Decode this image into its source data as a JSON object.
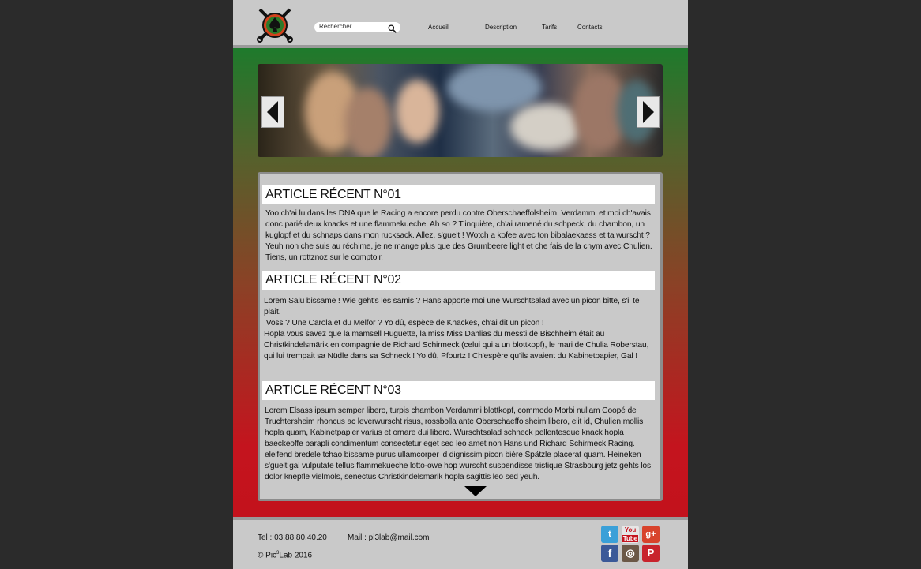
{
  "header": {
    "search_placeholder": "Rechercher...",
    "nav": [
      "Accueil",
      "Description",
      "Tarifs",
      "Contacts"
    ]
  },
  "articles": [
    {
      "title": "ARTICLE RÉCENT N°01",
      "text": "Yoo ch'ai lu dans les DNA que le Racing a encore perdu contre Oberschaeffolsheim. Verdammi et moi ch'avais donc parié deux knacks et une flammekueche. Ah so ? T'inquiète, ch'ai ramené du schpeck, du chambon, un kuglopf et du schnaps dans mon rucksack. Allez, s'guelt ! Wotch a kofee avec ton bibalaekaess et ta wurscht ? Yeuh non che suis au réchime, je ne mange plus que des Grumbeere light et che fais de la chym avec Chulien. Tiens, un rottznoz sur le comptoir."
    },
    {
      "title": "ARTICLE RÉCENT N°02",
      "lines": [
        "Lorem Salu bissame ! Wie geht's les samis ? Hans apporte moi une Wurschtsalad avec un picon bitte, s'il te plaît.",
        " Voss ? Une Carola et du Melfor ? Yo dû, espèce de Knäckes, ch'ai dit un picon !",
        "Hopla vous savez que la mamsell Huguette, la miss Miss Dahlias du messti de Bischheim était au Christkindelsmärik en compagnie de Richard Schirmeck (celui qui a un blottkopf), le mari de Chulia Roberstau, qui lui trempait sa Nüdle dans sa Schneck ! Yo dû, Pfourtz ! Ch'espère qu'ils avaient du Kabinetpapier, Gal !"
      ]
    },
    {
      "title": "ARTICLE RÉCENT N°03",
      "text": "Lorem Elsass ipsum semper libero, turpis chambon Verdammi blottkopf, commodo Morbi nullam Coopé de Truchtersheim rhoncus ac leverwurscht risus, rossbolla ante Oberschaeffolsheim libero, elit id, Chulien mollis hopla quam, Kabinetpapier varius et ornare dui libero. Wurschtsalad schneck pellentesque knack hopla baeckeoffe barapli condimentum consectetur eget sed leo amet non Hans und Richard Schirmeck Racing. eleifend bredele tchao bissame purus ullamcorper id dignissim picon bière Spätzle placerat quam. Heineken s'guelt gal vulputate tellus flammekueche lotto-owe hop wurscht suspendisse tristique Strasbourg jetz gehts los dolor knepfle vielmols, senectus Christkindelsmärik hopla sagittis leo sed yeuh."
    }
  ],
  "footer": {
    "tel": "Tel : 03.88.80.40.20",
    "mail": "Mail : pi3lab@mail.com",
    "copyright_pre": "© Pic",
    "copyright_sup": "3",
    "copyright_post": "Lab 2016"
  },
  "social": [
    {
      "name": "twitter-icon",
      "color": "#3aa0d8",
      "glyph": "t"
    },
    {
      "name": "youtube-icon",
      "color": "#e0e0e0",
      "glyph": "You"
    },
    {
      "name": "google-plus-icon",
      "color": "#d8432c",
      "glyph": "g+"
    },
    {
      "name": "facebook-icon",
      "color": "#3b5998",
      "glyph": "f"
    },
    {
      "name": "instagram-icon",
      "color": "#5a4a3a",
      "glyph": "◎"
    },
    {
      "name": "pinterest-icon",
      "color": "#c8232c",
      "glyph": "P"
    }
  ]
}
